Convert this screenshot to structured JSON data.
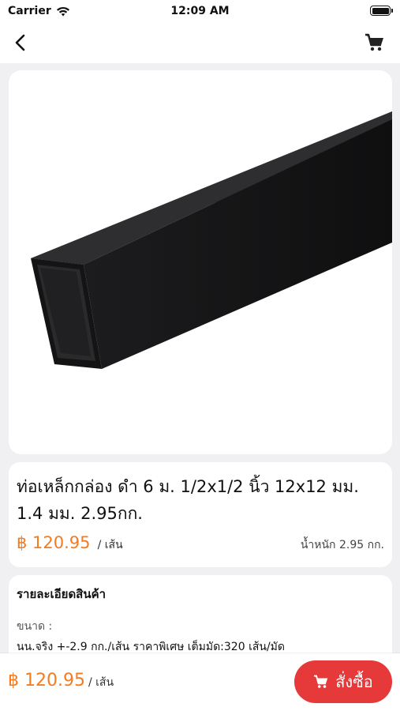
{
  "status": {
    "carrier": "Carrier",
    "time": "12:09 AM"
  },
  "product": {
    "title": "ท่อเหล็กกล่อง ดำ 6 ม. 1/2x1/2 นิ้ว 12x12 มม. 1.4 มม. 2.95กก.",
    "price": "฿ 120.95",
    "unit": "/ เส้น",
    "weight": "น้ำหนัก 2.95 กก."
  },
  "details": {
    "heading": "รายละเอียดสินค้า",
    "size_label": "ขนาด :",
    "size_value": "นน.จริง +-2.9 กก./เส้น ราคาพิเศษ เต็มมัด:320 เส้น/มัด"
  },
  "bottom": {
    "price": "฿ 120.95",
    "unit": "/ เส้น",
    "order_label": "สั่งซื้อ"
  },
  "colors": {
    "price": "#f47b20",
    "order_button": "#e5393a"
  },
  "icons": {
    "back": "chevron-left-icon",
    "cart": "cart-icon",
    "wifi": "wifi-icon",
    "battery": "battery-icon"
  }
}
